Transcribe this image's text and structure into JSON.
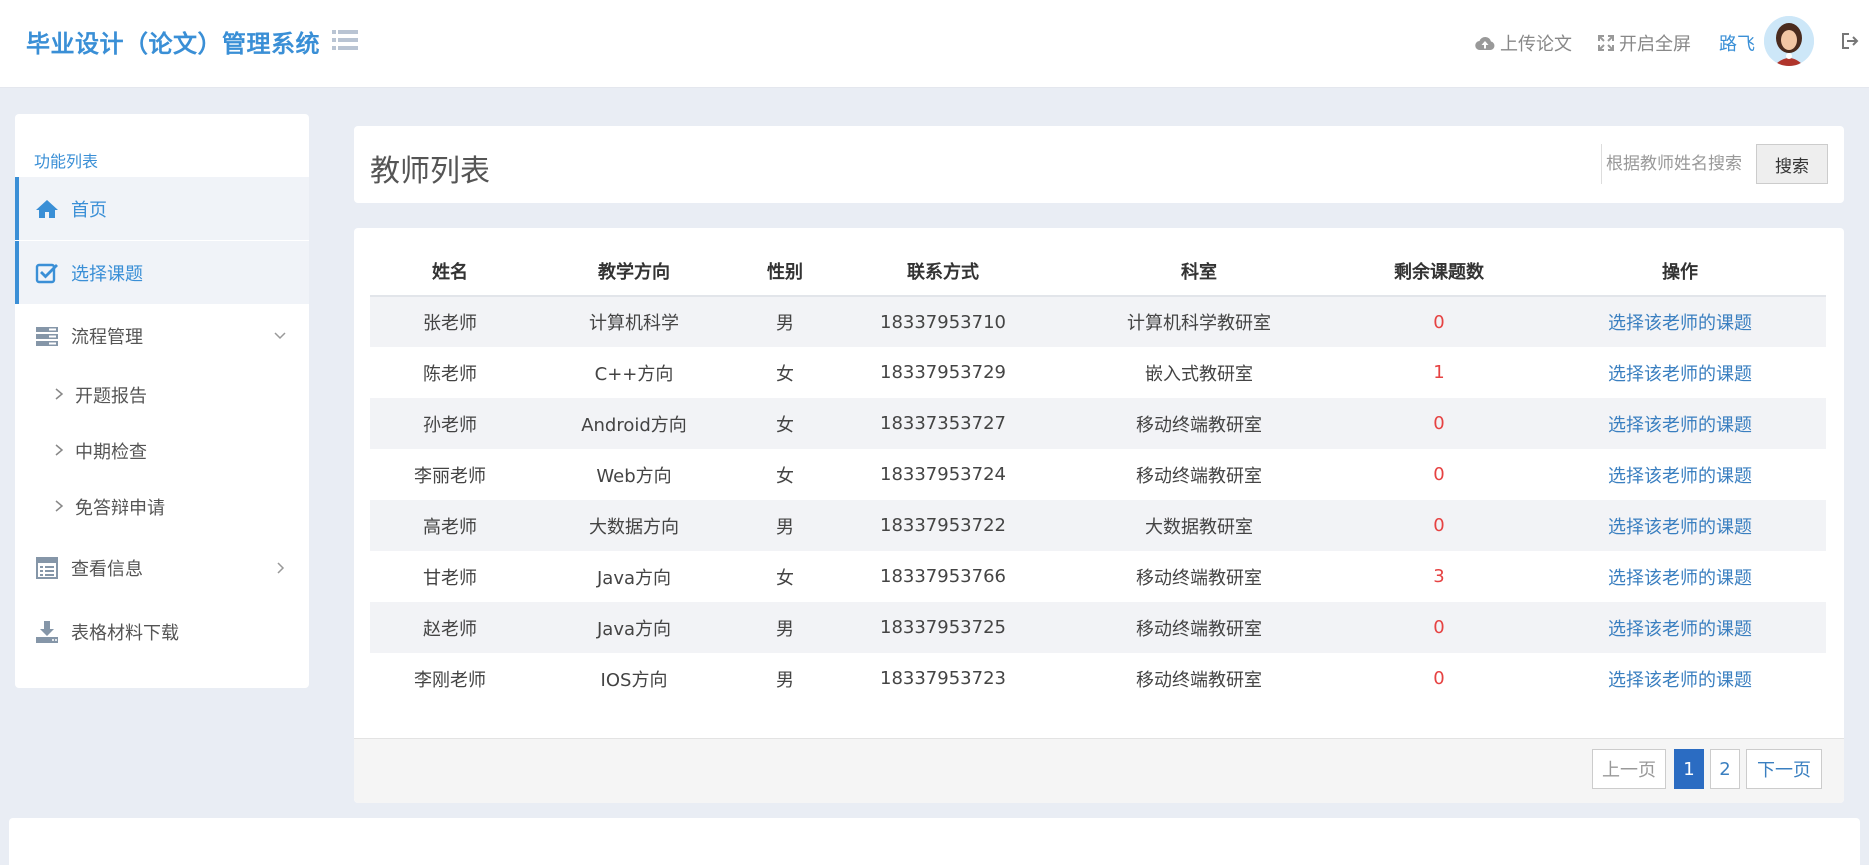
{
  "header": {
    "brand": "毕业设计（论文）管理系统",
    "upload_label": "上传论文",
    "fullscreen_label": "开启全屏",
    "user_name": "路飞"
  },
  "sidebar": {
    "title": "功能列表",
    "items": [
      {
        "label": "首页",
        "icon": "home-icon"
      },
      {
        "label": "选择课题",
        "icon": "checkbox-icon"
      },
      {
        "label": "流程管理",
        "icon": "process-icon"
      },
      {
        "label": "查看信息",
        "icon": "info-list-icon"
      },
      {
        "label": "表格材料下载",
        "icon": "download-icon"
      }
    ],
    "sub_items": [
      {
        "label": "开题报告"
      },
      {
        "label": "中期检查"
      },
      {
        "label": "免答辩申请"
      }
    ]
  },
  "main": {
    "title": "教师列表",
    "search_placeholder": "根据教师姓名搜索",
    "search_label": "搜索",
    "columns": [
      "姓名",
      "教学方向",
      "性别",
      "联系方式",
      "科室",
      "剩余课题数",
      "操作"
    ],
    "rows": [
      {
        "name": "张老师",
        "direction": "计算机科学",
        "gender": "男",
        "phone": "18337953710",
        "dept": "计算机科学教研室",
        "remaining": "0",
        "action": "选择该老师的课题"
      },
      {
        "name": "陈老师",
        "direction": "C++方向",
        "gender": "女",
        "phone": "18337953729",
        "dept": "嵌入式教研室",
        "remaining": "1",
        "action": "选择该老师的课题"
      },
      {
        "name": "孙老师",
        "direction": "Android方向",
        "gender": "女",
        "phone": "18337353727",
        "dept": "移动终端教研室",
        "remaining": "0",
        "action": "选择该老师的课题"
      },
      {
        "name": "李丽老师",
        "direction": "Web方向",
        "gender": "女",
        "phone": "18337953724",
        "dept": "移动终端教研室",
        "remaining": "0",
        "action": "选择该老师的课题"
      },
      {
        "name": "高老师",
        "direction": "大数据方向",
        "gender": "男",
        "phone": "18337953722",
        "dept": "大数据教研室",
        "remaining": "0",
        "action": "选择该老师的课题"
      },
      {
        "name": "甘老师",
        "direction": "Java方向",
        "gender": "女",
        "phone": "18337953766",
        "dept": "移动终端教研室",
        "remaining": "3",
        "action": "选择该老师的课题"
      },
      {
        "name": "赵老师",
        "direction": "Java方向",
        "gender": "男",
        "phone": "18337953725",
        "dept": "移动终端教研室",
        "remaining": "0",
        "action": "选择该老师的课题"
      },
      {
        "name": "李刚老师",
        "direction": "IOS方向",
        "gender": "男",
        "phone": "18337953723",
        "dept": "移动终端教研室",
        "remaining": "0",
        "action": "选择该老师的课题"
      }
    ],
    "pagination": {
      "prev": "上一页",
      "pages": [
        "1",
        "2"
      ],
      "current": "1",
      "next": "下一页"
    }
  },
  "colors": {
    "accent": "#3a8fd6",
    "link": "#3a7fc0",
    "danger": "#e64242",
    "page_active": "#2b6cc2"
  }
}
